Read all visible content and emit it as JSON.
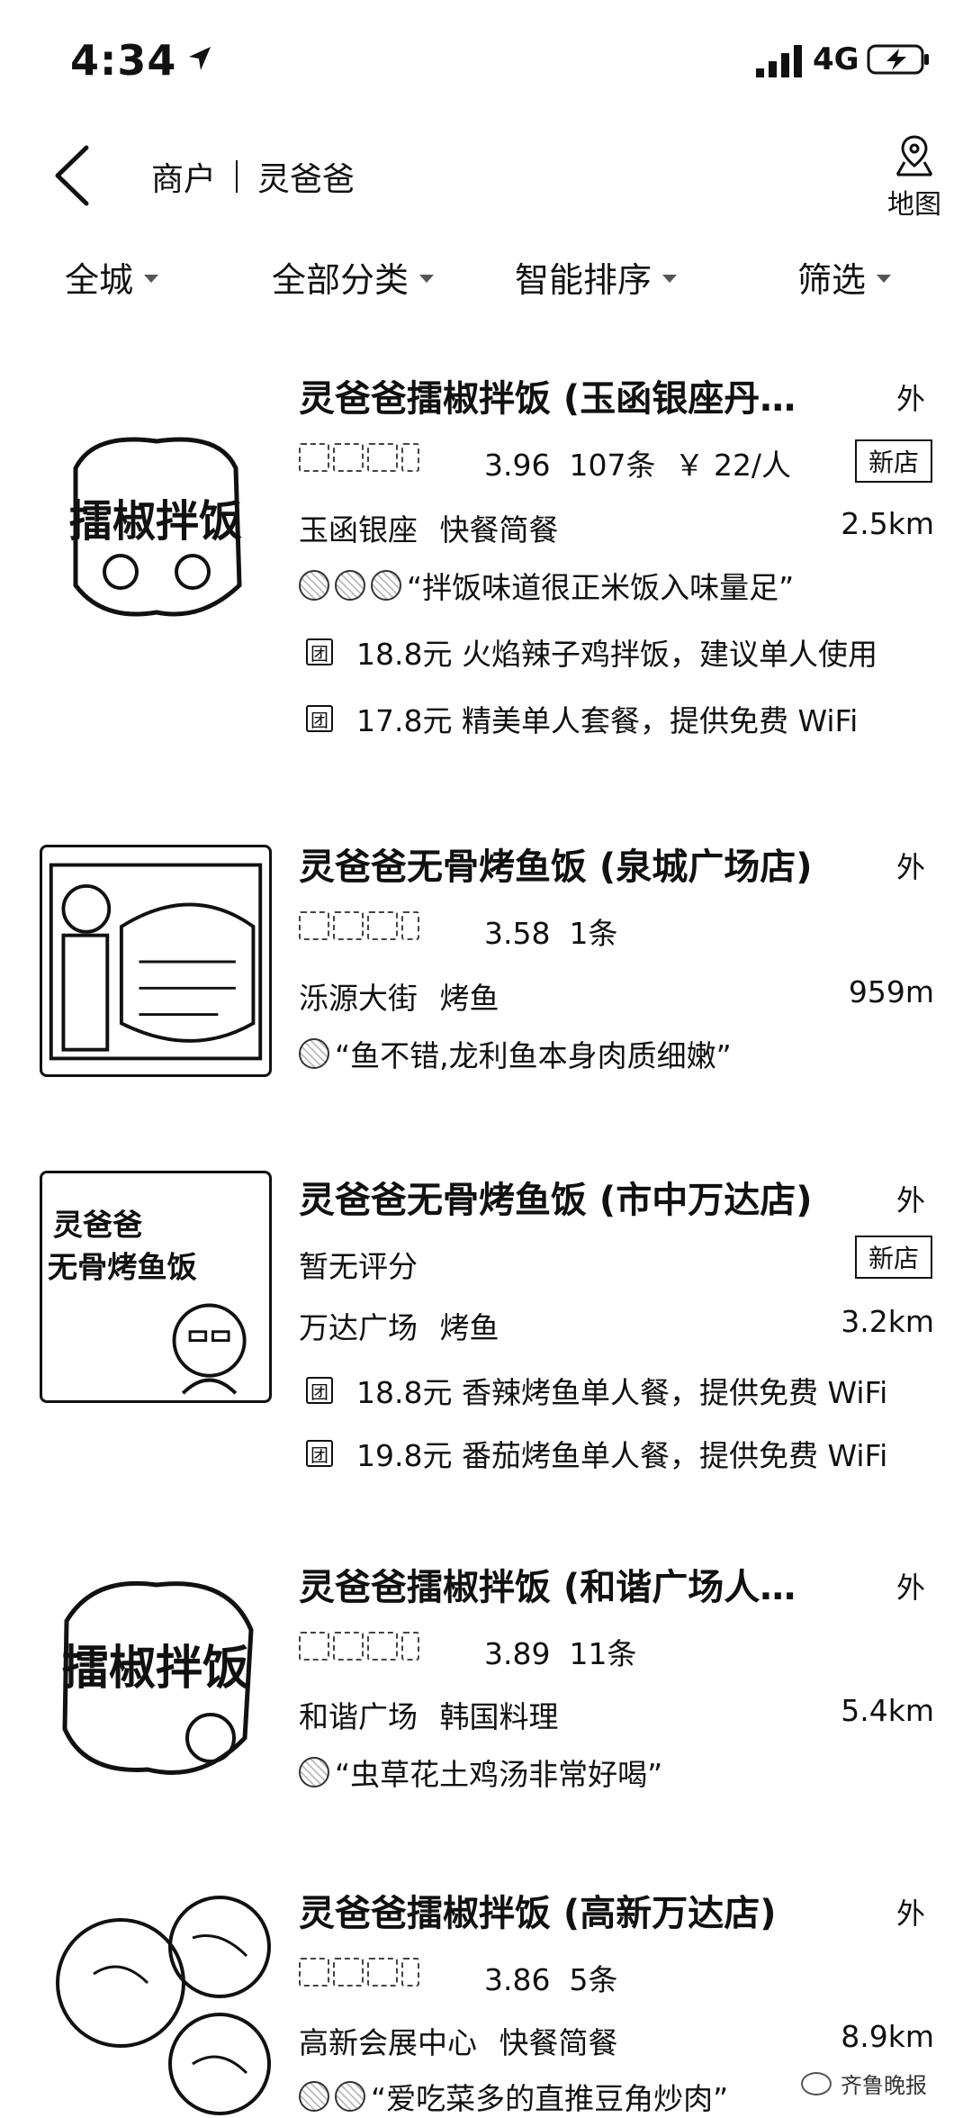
{
  "status_bar": {
    "time": "4:34",
    "network": "4G"
  },
  "nav": {
    "category": "商户",
    "query": "灵爸爸",
    "map_label": "地图"
  },
  "filters": [
    {
      "label": "全城"
    },
    {
      "label": "全部分类"
    },
    {
      "label": "智能排序"
    },
    {
      "label": "筛选"
    }
  ],
  "shops": [
    {
      "name": "灵爸爸擂椒拌饭 (玉函银座丹…",
      "takeout": "外",
      "rating": "3.96",
      "reviews": "107条",
      "price": "￥ 22/人",
      "badge": "新店",
      "area": "玉函银座",
      "category": "快餐简餐",
      "distance": "2.5km",
      "review_quote": "“拌饭味道很正米饭入味量足”",
      "deals": [
        {
          "icon": "团",
          "price": "18.8元",
          "desc": "火焰辣子鸡拌饭，建议单人使用"
        },
        {
          "icon": "团",
          "price": "17.8元",
          "desc": "精美单人套餐，提供免费 WiFi"
        }
      ]
    },
    {
      "name": "灵爸爸无骨烤鱼饭 (泉城广场店)",
      "takeout": "外",
      "rating": "3.58",
      "reviews": "1条",
      "area": "泺源大街",
      "category": "烤鱼",
      "distance": "959m",
      "review_quote": "“鱼不错,龙利鱼本身肉质细嫩”"
    },
    {
      "name": "灵爸爸无骨烤鱼饭 (市中万达店)",
      "takeout": "外",
      "no_rating": "暂无评分",
      "badge": "新店",
      "area": "万达广场",
      "category": "烤鱼",
      "distance": "3.2km",
      "deals": [
        {
          "icon": "团",
          "price": "18.8元",
          "desc": "香辣烤鱼单人餐，提供免费 WiFi"
        },
        {
          "icon": "团",
          "price": "19.8元",
          "desc": "番茄烤鱼单人餐，提供免费 WiFi"
        }
      ]
    },
    {
      "name": "灵爸爸擂椒拌饭 (和谐广场人…",
      "takeout": "外",
      "rating": "3.89",
      "reviews": "11条",
      "area": "和谐广场",
      "category": "韩国料理",
      "distance": "5.4km",
      "review_quote": "“虫草花土鸡汤非常好喝”"
    },
    {
      "name": "灵爸爸擂椒拌饭 (高新万达店)",
      "takeout": "外",
      "rating": "3.86",
      "reviews": "5条",
      "area": "高新会展中心",
      "category": "快餐简餐",
      "distance": "8.9km",
      "review_quote": "“爱吃菜多的直推豆角炒肉”"
    }
  ],
  "thumb_texts": {
    "shop1": "擂椒拌饭",
    "shop3_line1": "灵爸爸",
    "shop3_line2": "无骨烤鱼饭"
  },
  "watermark": "齐鲁晚报"
}
